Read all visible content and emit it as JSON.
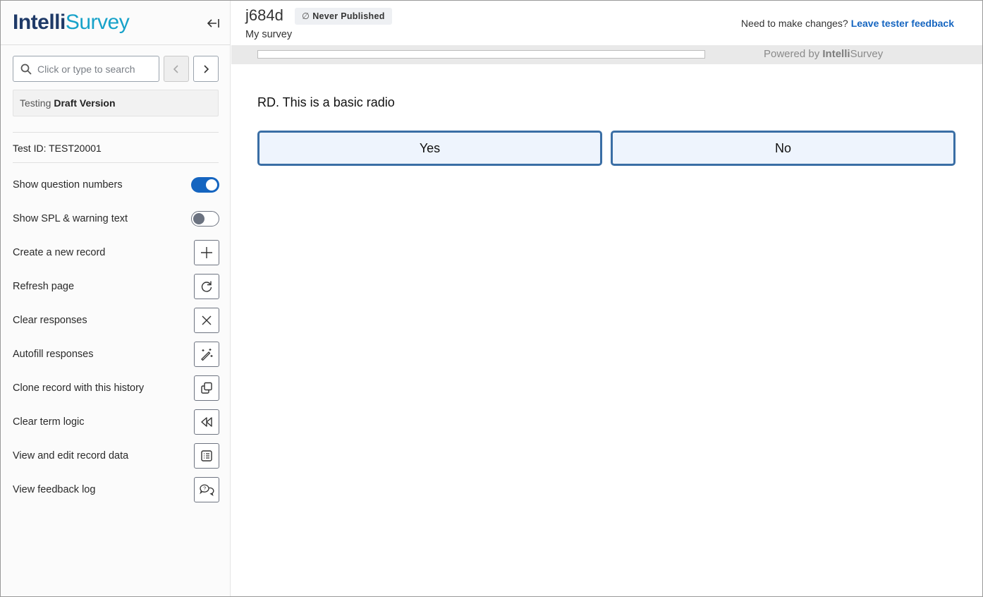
{
  "app": {
    "logo_part1": "Intelli",
    "logo_part2": "Survey"
  },
  "sidebar": {
    "search_placeholder": "Click or type to search",
    "version_prefix": "Testing",
    "version_name": "Draft Version",
    "test_id": "Test ID: TEST20001",
    "toggles": [
      {
        "label": "Show question numbers",
        "state": "on"
      },
      {
        "label": "Show SPL & warning text",
        "state": "off"
      }
    ],
    "actions": [
      {
        "label": "Create a new record",
        "icon": "plus-icon"
      },
      {
        "label": "Refresh page",
        "icon": "refresh-icon"
      },
      {
        "label": "Clear responses",
        "icon": "close-icon"
      },
      {
        "label": "Autofill responses",
        "icon": "magic-wand-icon"
      },
      {
        "label": "Clone record with this history",
        "icon": "clone-icon"
      },
      {
        "label": "Clear term logic",
        "icon": "rewind-icon"
      },
      {
        "label": "View and edit record data",
        "icon": "list-icon"
      },
      {
        "label": "View feedback log",
        "icon": "chat-icon"
      }
    ]
  },
  "header": {
    "survey_id": "j684d",
    "publish_status": "Never Published",
    "survey_name": "My survey",
    "feedback_prompt": "Need to make changes?",
    "feedback_link": "Leave tester feedback"
  },
  "progress": {
    "percent": 0,
    "powered_by": "Powered by",
    "brand_part1": "Intelli",
    "brand_part2": "Survey"
  },
  "question": {
    "text": "RD. This is a basic radio",
    "options": [
      "Yes",
      "No"
    ]
  },
  "colors": {
    "accent": "#1565c0",
    "answer_border": "#3a6ea5",
    "answer_bg": "#eef4fd",
    "logo_dark": "#1f3a68",
    "logo_light": "#17a2c9"
  }
}
